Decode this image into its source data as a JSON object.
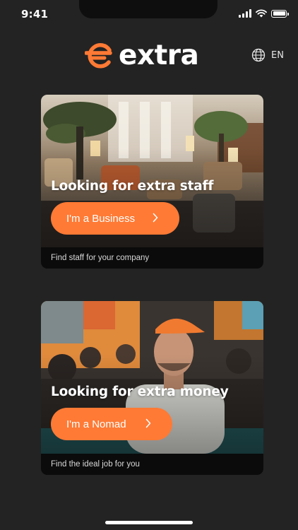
{
  "status_bar": {
    "time": "9:41"
  },
  "header": {
    "logo_text": "extra",
    "language": "EN",
    "icons": {
      "logo": "extra-logo-icon",
      "language": "globe-icon"
    }
  },
  "cards": [
    {
      "title": "Looking for extra staff",
      "button_label": "I'm a Business",
      "caption": "Find staff for your company"
    },
    {
      "title": "Looking for extra money",
      "button_label": "I'm a Nomad",
      "caption": "Find the ideal job for you"
    }
  ],
  "colors": {
    "background": "#232323",
    "accent": "#ff7a35",
    "card_footer": "#0b0b0b",
    "text": "#ffffff"
  }
}
